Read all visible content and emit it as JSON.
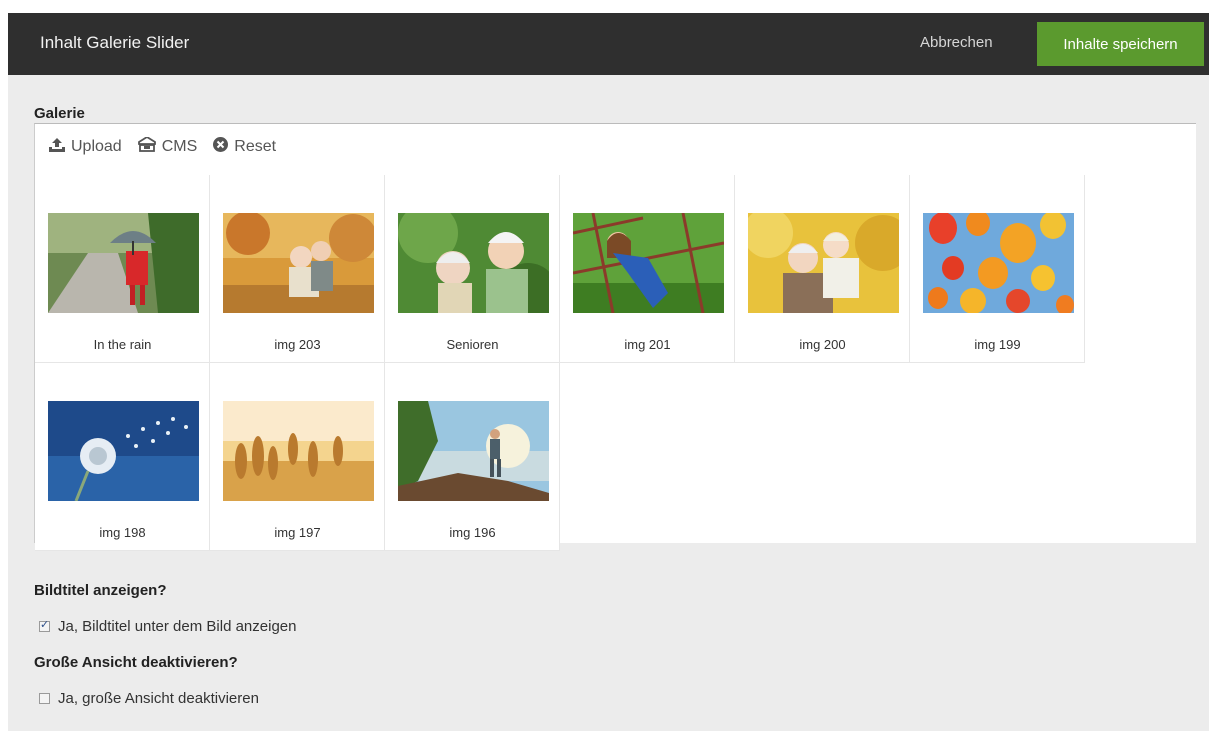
{
  "header": {
    "title": "Inhalt Galerie Slider",
    "cancel_label": "Abbrechen",
    "save_label": "Inhalte speichern",
    "save_color": "#5b9a2e"
  },
  "gallery": {
    "label": "Galerie",
    "toolbar": [
      {
        "label": "Upload",
        "icon": "upload-icon"
      },
      {
        "label": "CMS",
        "icon": "cms-icon"
      },
      {
        "label": "Reset",
        "icon": "reset-icon"
      }
    ],
    "items": [
      {
        "caption": "In the rain"
      },
      {
        "caption": "img 203"
      },
      {
        "caption": "Senioren"
      },
      {
        "caption": "img 201"
      },
      {
        "caption": "img 200"
      },
      {
        "caption": "img 199"
      },
      {
        "caption": "img 198"
      },
      {
        "caption": "img 197"
      },
      {
        "caption": "img 196"
      }
    ]
  },
  "options": {
    "show_titles": {
      "heading": "Bildtitel anzeigen?",
      "label": "Ja, Bildtitel unter dem Bild anzeigen",
      "checked": true
    },
    "disable_large": {
      "heading": "Große Ansicht deaktivieren?",
      "label": "Ja, große Ansicht deaktivieren",
      "checked": false
    }
  }
}
